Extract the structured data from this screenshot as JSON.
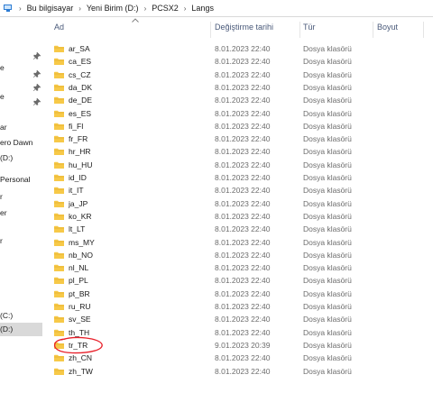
{
  "breadcrumb": {
    "items": [
      "Bu bilgisayar",
      "Yeni Birim (D:)",
      "PCSX2",
      "Langs"
    ],
    "separator": "›"
  },
  "sidebar": {
    "items": [
      {
        "label": "e",
        "pinned": true
      },
      {
        "label": "",
        "pinned": true
      },
      {
        "label": "",
        "pinned": true
      },
      {
        "label": "e",
        "pinned": true
      },
      {
        "label": "ar"
      },
      {
        "label": "ero Dawn"
      },
      {
        "label": "(D:)"
      },
      {
        "label": "Personal"
      },
      {
        "label": "r"
      },
      {
        "label": "er"
      },
      {
        "label": "r"
      },
      {
        "label": "(C:)"
      },
      {
        "label": "(D:)",
        "selected": true
      }
    ]
  },
  "columns": {
    "name": "Ad",
    "date": "Değiştirme tarihi",
    "type": "Tür",
    "size": "Boyut"
  },
  "files": [
    {
      "name": "ar_SA",
      "date": "8.01.2023 22:40",
      "type": "Dosya klasörü"
    },
    {
      "name": "ca_ES",
      "date": "8.01.2023 22:40",
      "type": "Dosya klasörü"
    },
    {
      "name": "cs_CZ",
      "date": "8.01.2023 22:40",
      "type": "Dosya klasörü"
    },
    {
      "name": "da_DK",
      "date": "8.01.2023 22:40",
      "type": "Dosya klasörü"
    },
    {
      "name": "de_DE",
      "date": "8.01.2023 22:40",
      "type": "Dosya klasörü"
    },
    {
      "name": "es_ES",
      "date": "8.01.2023 22:40",
      "type": "Dosya klasörü"
    },
    {
      "name": "fi_FI",
      "date": "8.01.2023 22:40",
      "type": "Dosya klasörü"
    },
    {
      "name": "fr_FR",
      "date": "8.01.2023 22:40",
      "type": "Dosya klasörü"
    },
    {
      "name": "hr_HR",
      "date": "8.01.2023 22:40",
      "type": "Dosya klasörü"
    },
    {
      "name": "hu_HU",
      "date": "8.01.2023 22:40",
      "type": "Dosya klasörü"
    },
    {
      "name": "id_ID",
      "date": "8.01.2023 22:40",
      "type": "Dosya klasörü"
    },
    {
      "name": "it_IT",
      "date": "8.01.2023 22:40",
      "type": "Dosya klasörü"
    },
    {
      "name": "ja_JP",
      "date": "8.01.2023 22:40",
      "type": "Dosya klasörü"
    },
    {
      "name": "ko_KR",
      "date": "8.01.2023 22:40",
      "type": "Dosya klasörü"
    },
    {
      "name": "lt_LT",
      "date": "8.01.2023 22:40",
      "type": "Dosya klasörü"
    },
    {
      "name": "ms_MY",
      "date": "8.01.2023 22:40",
      "type": "Dosya klasörü"
    },
    {
      "name": "nb_NO",
      "date": "8.01.2023 22:40",
      "type": "Dosya klasörü"
    },
    {
      "name": "nl_NL",
      "date": "8.01.2023 22:40",
      "type": "Dosya klasörü"
    },
    {
      "name": "pl_PL",
      "date": "8.01.2023 22:40",
      "type": "Dosya klasörü"
    },
    {
      "name": "pt_BR",
      "date": "8.01.2023 22:40",
      "type": "Dosya klasörü"
    },
    {
      "name": "ru_RU",
      "date": "8.01.2023 22:40",
      "type": "Dosya klasörü"
    },
    {
      "name": "sv_SE",
      "date": "8.01.2023 22:40",
      "type": "Dosya klasörü"
    },
    {
      "name": "th_TH",
      "date": "8.01.2023 22:40",
      "type": "Dosya klasörü"
    },
    {
      "name": "tr_TR",
      "date": "9.01.2023 20:39",
      "type": "Dosya klasörü",
      "annotated": true
    },
    {
      "name": "zh_CN",
      "date": "8.01.2023 22:40",
      "type": "Dosya klasörü"
    },
    {
      "name": "zh_TW",
      "date": "8.01.2023 22:40",
      "type": "Dosya klasörü"
    }
  ],
  "colors": {
    "folder": "#f7c948",
    "folder_dark": "#e0a92a",
    "header_text": "#4a5a7a",
    "annotation": "#e8202a",
    "selected_bg": "#d9d9d9"
  },
  "icons": {
    "breadcrumb": "computer-icon",
    "folder": "folder-icon",
    "pin": "pin-icon",
    "sort": "sort-caret-icon"
  }
}
